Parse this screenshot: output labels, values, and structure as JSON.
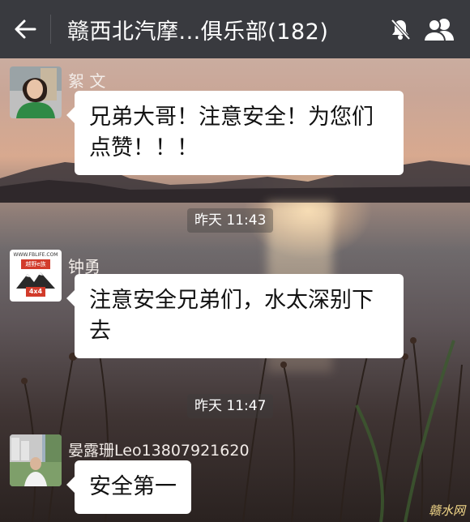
{
  "header": {
    "title": "赣西北汽摩...俱乐部(182)",
    "back_icon": "arrow-left-icon",
    "mute_icon": "bell-muted-icon",
    "members_icon": "group-members-icon"
  },
  "messages": [
    {
      "sender": "絮 文",
      "text_lines": [
        "兄弟大哥！注意安全！为您们",
        "点赞！！！"
      ]
    },
    {
      "sender": "钟勇",
      "text_lines": [
        "注意安全兄弟们，水太深别下",
        "去"
      ],
      "avatar_text_top": "WWW.FBLIFE.COM",
      "avatar_text_mid": "越野e族",
      "avatar_text_badge": "4x4"
    },
    {
      "sender": "晏露珊Leo13807921620",
      "text_lines": [
        "安全第一"
      ]
    }
  ],
  "timestamps": [
    "昨天 11:43",
    "昨天 11:47"
  ],
  "watermark": "赣水网",
  "colors": {
    "header_bg": "#393a3f",
    "bubble_bg": "#ffffff"
  }
}
